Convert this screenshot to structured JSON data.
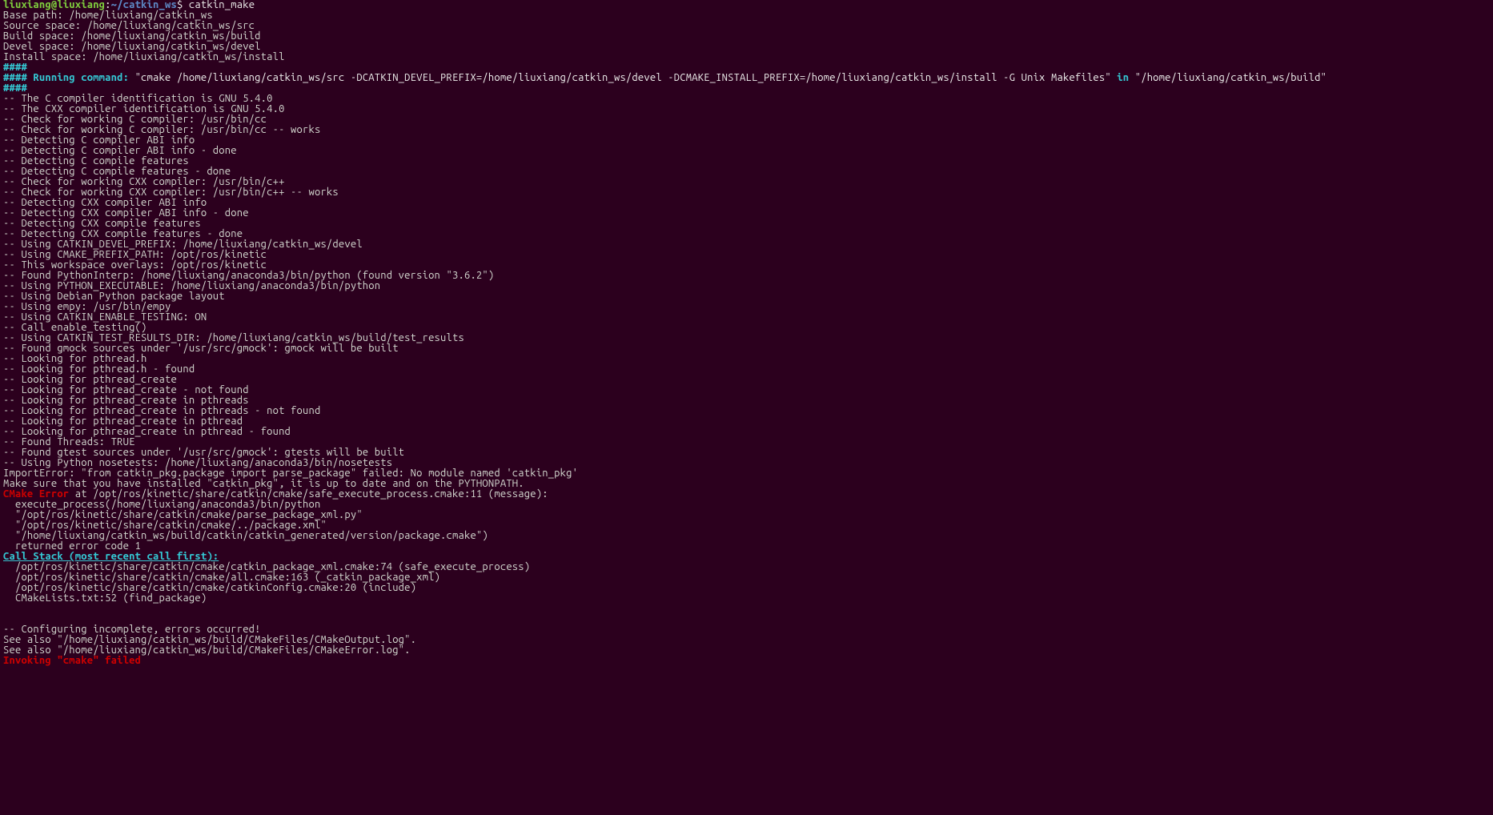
{
  "prompt": {
    "user_host": "liuxiang@liuxiang",
    "colon": ":",
    "cwd": "~/catkin_ws",
    "dollar": "$",
    "cmd": " catkin_make"
  },
  "paths": {
    "base": "Base path: /home/liuxiang/catkin_ws",
    "source": "Source space: /home/liuxiang/catkin_ws/src",
    "build": "Build space: /home/liuxiang/catkin_ws/build",
    "devel": "Devel space: /home/liuxiang/catkin_ws/devel",
    "install": "Install space: /home/liuxiang/catkin_ws/install"
  },
  "hash_top": "####",
  "running": {
    "prefix": "#### Running command: ",
    "cmd": "\"cmake /home/liuxiang/catkin_ws/src -DCATKIN_DEVEL_PREFIX=/home/liuxiang/catkin_ws/devel -DCMAKE_INSTALL_PREFIX=/home/liuxiang/catkin_ws/install -G Unix Makefiles\"",
    "in": " in ",
    "build_dir": "\"/home/liuxiang/catkin_ws/build\""
  },
  "hash_bot": "####",
  "cmake_lines": [
    "-- The C compiler identification is GNU 5.4.0",
    "-- The CXX compiler identification is GNU 5.4.0",
    "-- Check for working C compiler: /usr/bin/cc",
    "-- Check for working C compiler: /usr/bin/cc -- works",
    "-- Detecting C compiler ABI info",
    "-- Detecting C compiler ABI info - done",
    "-- Detecting C compile features",
    "-- Detecting C compile features - done",
    "-- Check for working CXX compiler: /usr/bin/c++",
    "-- Check for working CXX compiler: /usr/bin/c++ -- works",
    "-- Detecting CXX compiler ABI info",
    "-- Detecting CXX compiler ABI info - done",
    "-- Detecting CXX compile features",
    "-- Detecting CXX compile features - done",
    "-- Using CATKIN_DEVEL_PREFIX: /home/liuxiang/catkin_ws/devel",
    "-- Using CMAKE_PREFIX_PATH: /opt/ros/kinetic",
    "-- This workspace overlays: /opt/ros/kinetic",
    "-- Found PythonInterp: /home/liuxiang/anaconda3/bin/python (found version \"3.6.2\")",
    "-- Using PYTHON_EXECUTABLE: /home/liuxiang/anaconda3/bin/python",
    "-- Using Debian Python package layout",
    "-- Using empy: /usr/bin/empy",
    "-- Using CATKIN_ENABLE_TESTING: ON",
    "-- Call enable_testing()",
    "-- Using CATKIN_TEST_RESULTS_DIR: /home/liuxiang/catkin_ws/build/test_results",
    "-- Found gmock sources under '/usr/src/gmock': gmock will be built",
    "-- Looking for pthread.h",
    "-- Looking for pthread.h - found",
    "-- Looking for pthread_create",
    "-- Looking for pthread_create - not found",
    "-- Looking for pthread_create in pthreads",
    "-- Looking for pthread_create in pthreads - not found",
    "-- Looking for pthread_create in pthread",
    "-- Looking for pthread_create in pthread - found",
    "-- Found Threads: TRUE",
    "-- Found gtest sources under '/usr/src/gmock': gtests will be built",
    "-- Using Python nosetests: /home/liuxiang/anaconda3/bin/nosetests",
    "ImportError: \"from catkin_pkg.package import parse_package\" failed: No module named 'catkin_pkg'",
    "Make sure that you have installed \"catkin_pkg\", it is up to date and on the PYTHONPATH."
  ],
  "cmake_error": {
    "label": "CMake Error",
    "rest": " at /opt/ros/kinetic/share/catkin/cmake/safe_execute_process.cmake:11 (message):"
  },
  "err_lines": [
    "  execute_process(/home/liuxiang/anaconda3/bin/python",
    "  \"/opt/ros/kinetic/share/catkin/cmake/parse_package_xml.py\"",
    "  \"/opt/ros/kinetic/share/catkin/cmake/../package.xml\"",
    "  \"/home/liuxiang/catkin_ws/build/catkin/catkin_generated/version/package.cmake\")",
    "  returned error code 1"
  ],
  "callstack_header": "Call Stack (most recent call first):",
  "callstack_lines": [
    "  /opt/ros/kinetic/share/catkin/cmake/catkin_package_xml.cmake:74 (safe_execute_process)",
    "  /opt/ros/kinetic/share/catkin/cmake/all.cmake:163 (_catkin_package_xml)",
    "  /opt/ros/kinetic/share/catkin/cmake/catkinConfig.cmake:20 (include)",
    "  CMakeLists.txt:52 (find_package)"
  ],
  "blank": "",
  "configuring": "-- Configuring incomplete, errors occurred!",
  "see_also": [
    "See also \"/home/liuxiang/catkin_ws/build/CMakeFiles/CMakeOutput.log\".",
    "See also \"/home/liuxiang/catkin_ws/build/CMakeFiles/CMakeError.log\"."
  ],
  "invoking": {
    "pre": "Invoking ",
    "cmd": "\"cmake\"",
    "suf": " failed"
  }
}
